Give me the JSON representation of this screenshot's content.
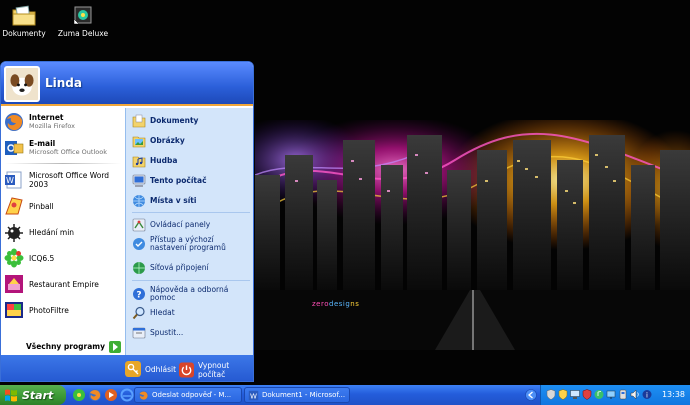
{
  "desktop": {
    "icons": [
      {
        "label": "Dokumenty",
        "icon": "folder-icon"
      },
      {
        "label": "Zuma Deluxe",
        "icon": "zuma-icon"
      }
    ],
    "wallpaper_credit": [
      "zero",
      "desig",
      "ns"
    ]
  },
  "start_menu": {
    "user_name": "Linda",
    "pinned": [
      {
        "title": "Internet",
        "subtitle": "Mozilla Firefox",
        "icon": "firefox-icon"
      },
      {
        "title": "E-mail",
        "subtitle": "Microsoft Office Outlook",
        "icon": "outlook-icon"
      }
    ],
    "recent": [
      {
        "title": "Microsoft Office Word 2003",
        "icon": "word-icon"
      },
      {
        "title": "Pinball",
        "icon": "pinball-icon"
      },
      {
        "title": "Hledání min",
        "icon": "minesweeper-icon"
      },
      {
        "title": "ICQ6.5",
        "icon": "icq-icon"
      },
      {
        "title": "Restaurant Empire",
        "icon": "restaurant-icon"
      },
      {
        "title": "PhotoFiltre",
        "icon": "photofiltre-icon"
      }
    ],
    "all_programs": "Všechny programy",
    "places": [
      {
        "label": "Dokumenty",
        "icon": "documents-icon"
      },
      {
        "label": "Obrázky",
        "icon": "pictures-icon"
      },
      {
        "label": "Hudba",
        "icon": "music-icon"
      },
      {
        "label": "Tento počítač",
        "icon": "computer-icon"
      },
      {
        "label": "Místa v síti",
        "icon": "network-icon"
      }
    ],
    "settings": [
      {
        "label": "Ovládací panely",
        "icon": "control-panel-icon"
      },
      {
        "label": "Přístup a výchozí nastavení programů",
        "icon": "default-programs-icon"
      },
      {
        "label": "Síťová připojení",
        "icon": "network-connections-icon"
      }
    ],
    "tools": [
      {
        "label": "Nápověda a odborná pomoc",
        "icon": "help-icon"
      },
      {
        "label": "Hledat",
        "icon": "search-icon"
      },
      {
        "label": "Spustit...",
        "icon": "run-icon"
      }
    ],
    "logoff": "Odhlásit",
    "shutdown": "Vypnout počítač"
  },
  "taskbar": {
    "start_label": "Start",
    "tasks": [
      {
        "label": "Odeslat odpověď - M...",
        "icon": "firefox-icon"
      },
      {
        "label": "Dokument1 - Microsof...",
        "icon": "word-icon"
      }
    ],
    "clock": "13:38"
  },
  "colors": {
    "start_green": "#3c9a36",
    "taskbar_blue": "#245ddb",
    "tray_blue": "#1076e0",
    "menu_right_bg": "#d3e5fa",
    "menu_header": "#2b5fd9"
  }
}
